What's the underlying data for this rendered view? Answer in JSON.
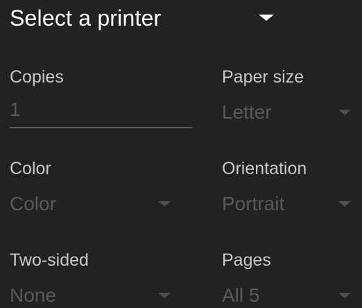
{
  "printer": {
    "label": "Select a printer"
  },
  "copies": {
    "label": "Copies",
    "value": "1"
  },
  "paper_size": {
    "label": "Paper size",
    "value": "Letter"
  },
  "color": {
    "label": "Color",
    "value": "Color"
  },
  "orientation": {
    "label": "Orientation",
    "value": "Portrait"
  },
  "two_sided": {
    "label": "Two-sided",
    "value": "None"
  },
  "pages": {
    "label": "Pages",
    "value": "All 5"
  },
  "colors": {
    "background": "#222222",
    "title_text": "#ffffff",
    "label_text": "#c8c8c8",
    "disabled_value": "#5a5a5a"
  },
  "icons": [
    "caret-down-icon"
  ]
}
